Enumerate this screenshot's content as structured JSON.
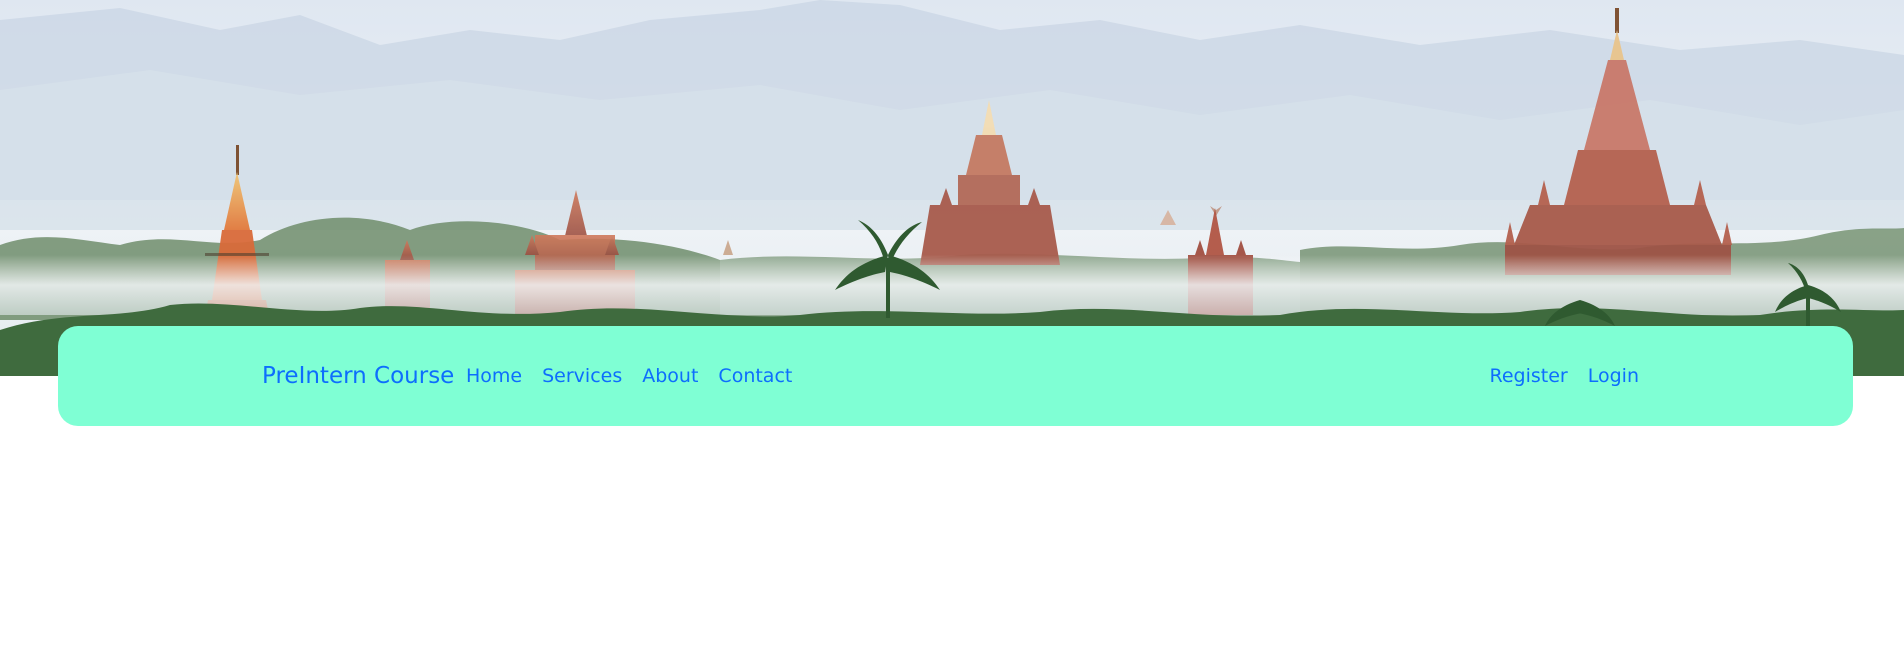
{
  "hero": {
    "image": "pagoda-landscape-banner",
    "colors": {
      "sky": "#e7eef5",
      "mist": "#dfe8ef",
      "pagoda": "#b5614f",
      "trees": "#3f6b3e"
    }
  },
  "navbar": {
    "background": "#7fffd4",
    "link_color": "#0d6efd",
    "brand": "PreIntern Course",
    "left_links": [
      "Home",
      "Services",
      "About",
      "Contact"
    ],
    "right_links": [
      "Register",
      "Login"
    ]
  }
}
